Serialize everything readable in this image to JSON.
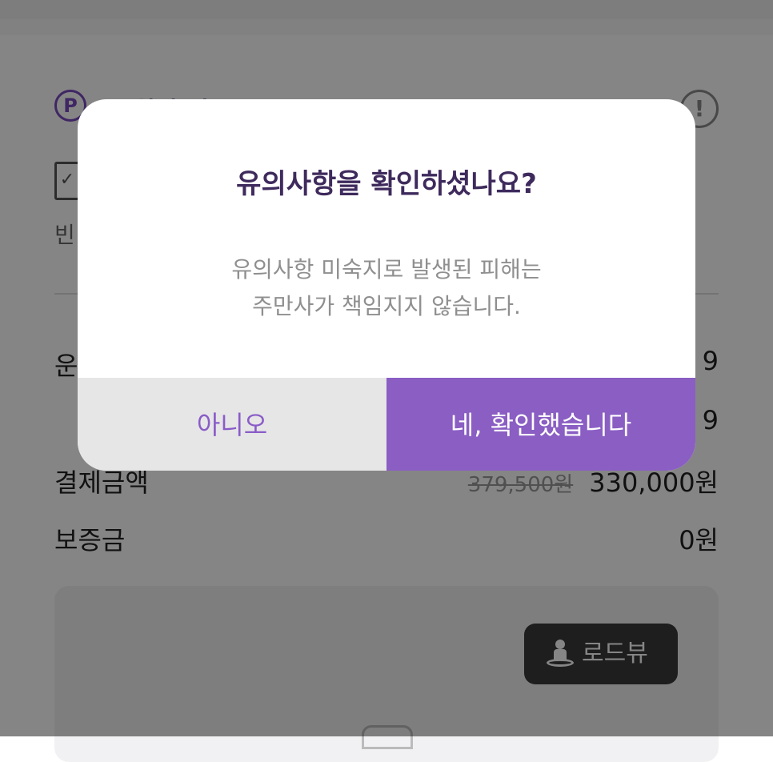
{
  "section": {
    "title": "주차장 정보",
    "badge_letter": "P",
    "alert_glyph": "!"
  },
  "content": {
    "check_glyph": "✓",
    "small_text": "빈"
  },
  "rows": [
    {
      "label": "운",
      "value": "9"
    },
    {
      "label": "",
      "value": "9"
    },
    {
      "label": "결제금액",
      "original": "379,500원",
      "value": "330,000원"
    },
    {
      "label": "보증금",
      "value": "0원"
    }
  ],
  "map": {
    "roadview_label": "로드뷰"
  },
  "dialog": {
    "title": "유의사항을 확인하셨나요?",
    "message_line1": "유의사항 미숙지로 발생된 피해는",
    "message_line2": "주만사가 책임지지 않습니다.",
    "no_label": "아니오",
    "yes_label": "네, 확인했습니다"
  },
  "colors": {
    "accent": "#8a5ec3",
    "title": "#3e2a5c",
    "no_text": "#8a5cc8"
  }
}
